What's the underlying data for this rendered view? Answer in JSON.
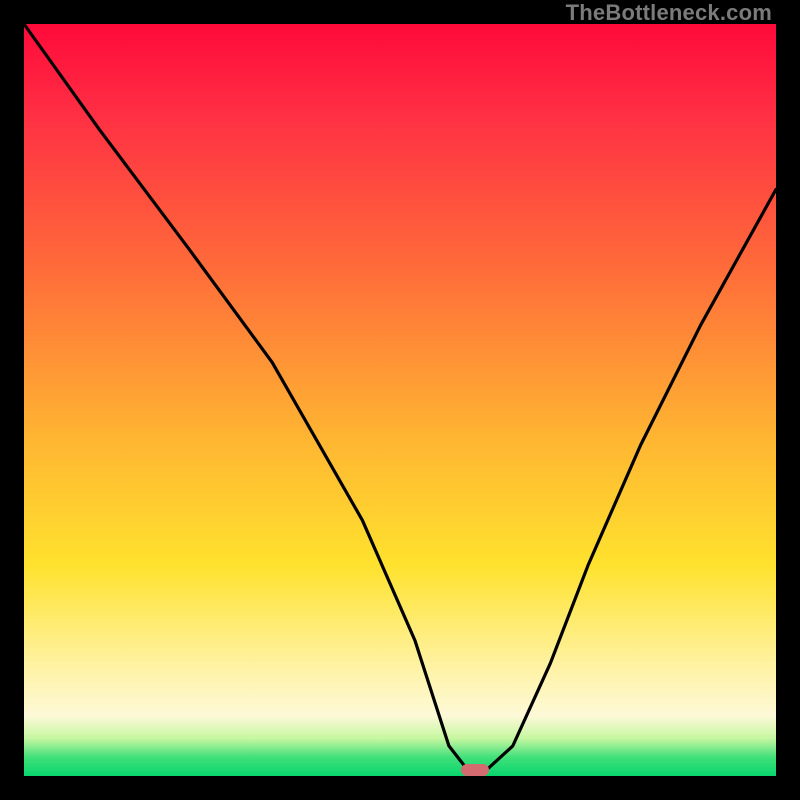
{
  "watermark": "TheBottleneck.com",
  "chart_data": {
    "type": "line",
    "title": "",
    "xlabel": "",
    "ylabel": "",
    "xlim": [
      0,
      100
    ],
    "ylim": [
      0,
      100
    ],
    "grid": false,
    "series": [
      {
        "name": "bottleneck-curve",
        "x": [
          0,
          10,
          22,
          33,
          45,
          52,
          56.5,
          59,
          61.5,
          65,
          70,
          75,
          82,
          90,
          100
        ],
        "values": [
          100,
          86,
          70,
          55,
          34,
          18,
          4,
          0.8,
          0.8,
          4,
          15,
          28,
          44,
          60,
          78
        ]
      }
    ],
    "annotations": [
      {
        "name": "optimal-marker",
        "x": 60,
        "y": 0.8
      }
    ],
    "gradient_stops": [
      {
        "pos": 0,
        "color": "#ff0a3a"
      },
      {
        "pos": 0.55,
        "color": "#ffe22e"
      },
      {
        "pos": 0.92,
        "color": "#fdf9d8"
      },
      {
        "pos": 1.0,
        "color": "#08d66e"
      }
    ]
  },
  "marker": {
    "color": "#d36a6f"
  }
}
